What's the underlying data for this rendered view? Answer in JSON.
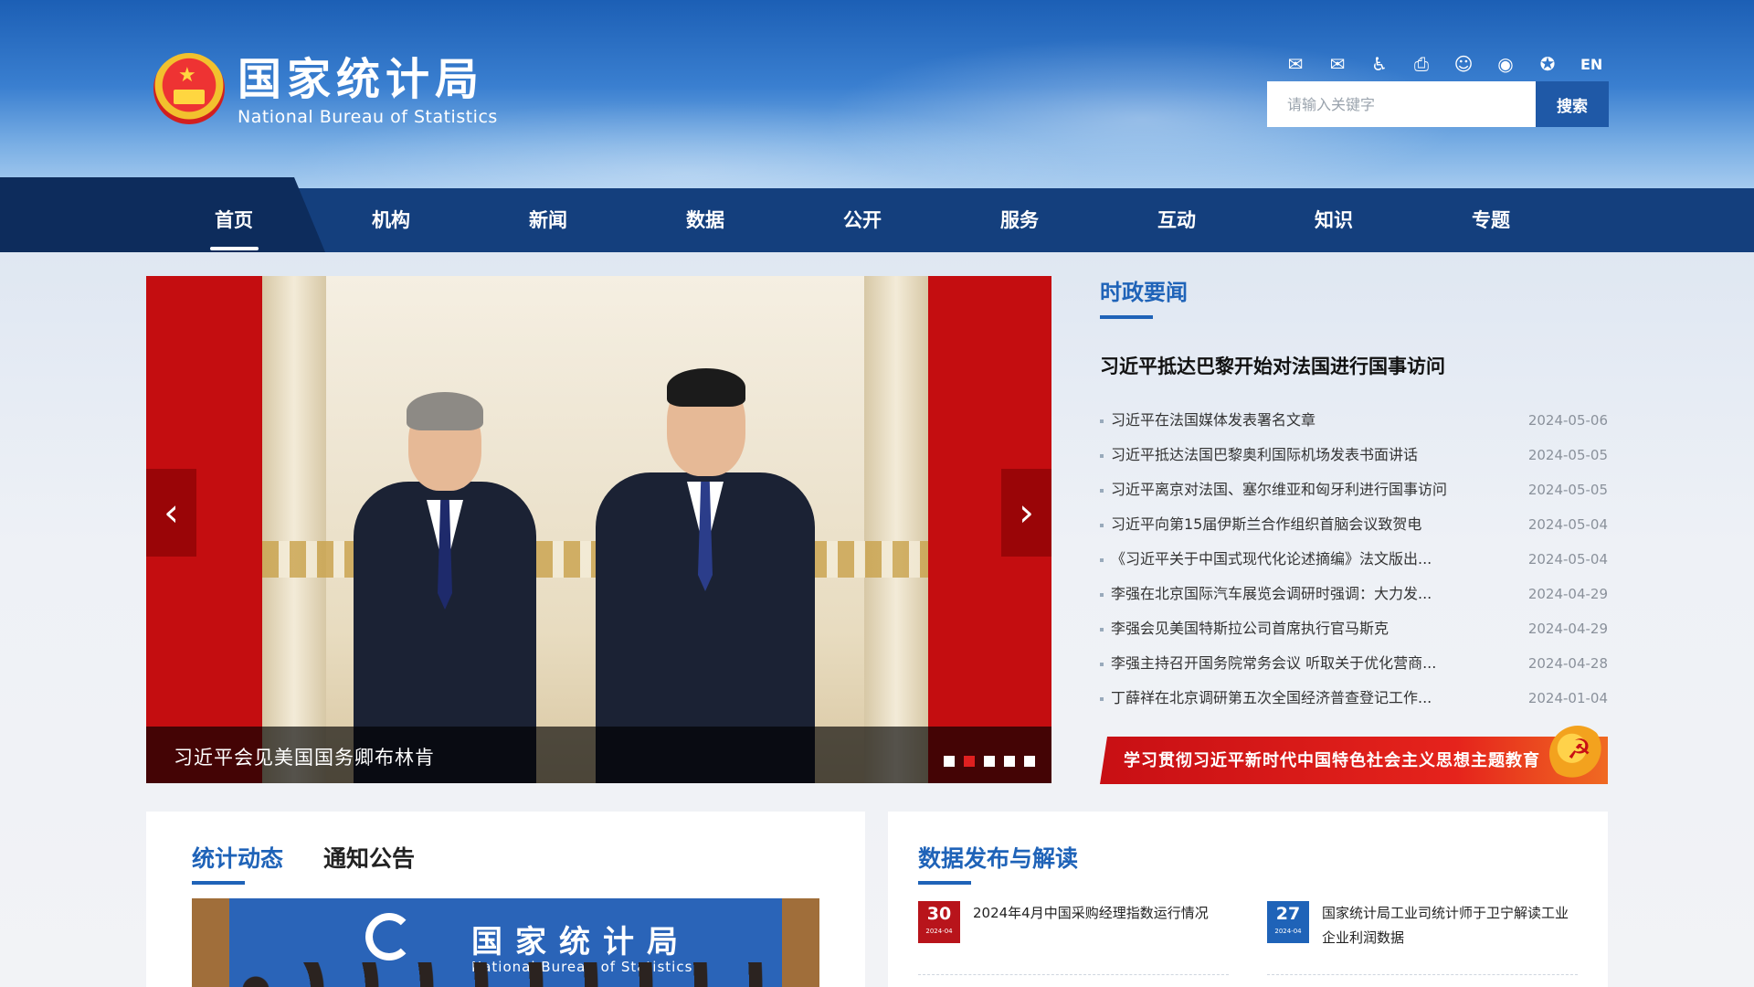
{
  "header": {
    "logo_cn": "国家统计局",
    "logo_en": "National Bureau of Statistics",
    "tools": [
      {
        "icon": "mail-icon",
        "glyph": "✉"
      },
      {
        "icon": "subscribe-icon",
        "glyph": "✉"
      },
      {
        "icon": "accessibility-icon",
        "glyph": "♿"
      },
      {
        "icon": "print-icon",
        "glyph": "⎙"
      },
      {
        "icon": "robot-icon",
        "glyph": "☺"
      },
      {
        "icon": "weibo-icon",
        "glyph": "◉"
      },
      {
        "icon": "wechat-icon",
        "glyph": "✪"
      }
    ],
    "lang": "EN",
    "search_placeholder": "请输入关键字",
    "search_button": "搜索"
  },
  "nav": {
    "items": [
      "首页",
      "机构",
      "新闻",
      "数据",
      "公开",
      "服务",
      "互动",
      "知识",
      "专题"
    ],
    "active_index": 0
  },
  "carousel": {
    "caption": "习近平会见美国国务卿布林肯",
    "prev": "‹",
    "next": "›",
    "slide_count": 5,
    "active_slide": 1
  },
  "news": {
    "title": "时政要闻",
    "headline": "习近平抵达巴黎开始对法国进行国事访问",
    "items": [
      {
        "title": "习近平在法国媒体发表署名文章",
        "date": "2024-05-06"
      },
      {
        "title": "习近平抵达法国巴黎奥利国际机场发表书面讲话",
        "date": "2024-05-05"
      },
      {
        "title": "习近平离京对法国、塞尔维亚和匈牙利进行国事访问",
        "date": "2024-05-05"
      },
      {
        "title": "习近平向第15届伊斯兰合作组织首脑会议致贺电",
        "date": "2024-05-04"
      },
      {
        "title": "《习近平关于中国式现代化论述摘编》法文版出...",
        "date": "2024-05-04"
      },
      {
        "title": "李强在北京国际汽车展览会调研时强调：大力发...",
        "date": "2024-04-29"
      },
      {
        "title": "李强会见美国特斯拉公司首席执行官马斯克",
        "date": "2024-04-29"
      },
      {
        "title": "李强主持召开国务院常务会议 听取关于优化营商...",
        "date": "2024-04-28"
      },
      {
        "title": "丁薛祥在北京调研第五次全国经济普查登记工作...",
        "date": "2024-01-04"
      }
    ]
  },
  "banner": {
    "text": "学习贯彻习近平新时代中国特色社会主义思想主题教育"
  },
  "dynamics": {
    "tabs": [
      "统计动态",
      "通知公告"
    ],
    "active_tab": 0,
    "photo_cn": "国家统计局",
    "photo_en": "National Bureau of Statistics"
  },
  "releases": {
    "title": "数据发布与解读",
    "items": [
      {
        "day": "30",
        "ym": "2024-04",
        "title": "2024年4月中国采购经理指数运行情况",
        "color": "#b8141b"
      },
      {
        "day": "27",
        "ym": "2024-04",
        "title": "国家统计局工业司统计师于卫宁解读工业企业利润数据",
        "color": "#1f63b8"
      }
    ]
  },
  "colors": {
    "nav_bg": "#143f7d",
    "accent_blue": "#1f63b8",
    "accent_red": "#c40d10"
  }
}
